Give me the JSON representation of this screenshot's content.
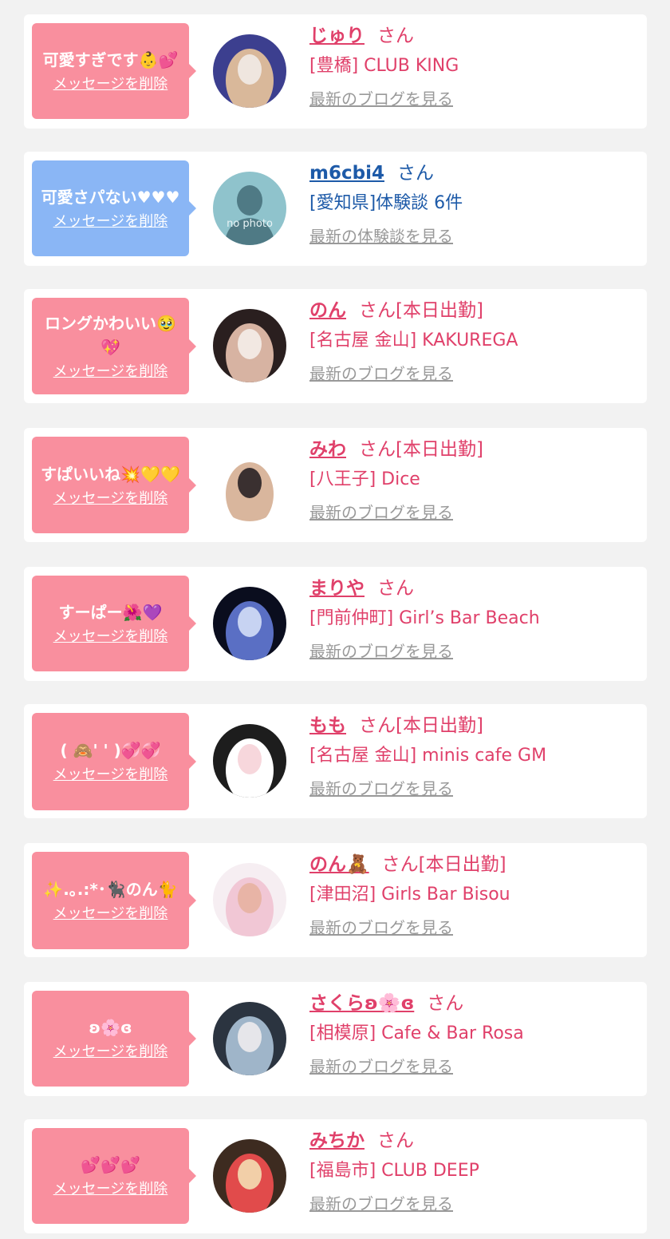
{
  "colors": {
    "page_bg": "#f2f2f2",
    "card_bg": "#ffffff",
    "bubble_pink": "#f98f9e",
    "bubble_blue": "#8ab6f5",
    "name_pink": "#e0406a",
    "name_blue": "#1d5aa8",
    "link_gray": "#999999"
  },
  "delete_label": "メッセージを削除",
  "entries": [
    {
      "message": "可愛すぎです👶💕",
      "name": "じゅり",
      "honorific": "さん",
      "tag": "",
      "shop": "[豊橋] CLUB KING",
      "link": "最新のブログを見る",
      "avatar_icon": "photo-avatar-icon",
      "theme": "pink"
    },
    {
      "message": "可愛さパない♥♥♥",
      "name": "m6cbi4",
      "honorific": "さん",
      "tag": "",
      "shop": "[愛知県]体験談 6件",
      "link": "最新の体験談を見る",
      "avatar_icon": "no-photo-avatar-icon",
      "avatar_text": "no photo",
      "theme": "blue"
    },
    {
      "message": "ロングかわいい🥹💖",
      "name": "のん",
      "honorific": "さん",
      "tag": "[本日出勤]",
      "shop": "[名古屋 金山] KAKUREGA",
      "link": "最新のブログを見る",
      "avatar_icon": "photo-avatar-icon",
      "theme": "pink"
    },
    {
      "message": "すぱいいね💥💛💛",
      "name": "みわ",
      "honorific": "さん",
      "tag": "[本日出勤]",
      "shop": "[八王子] Dice",
      "link": "最新のブログを見る",
      "avatar_icon": "photo-avatar-icon",
      "theme": "pink"
    },
    {
      "message": "すーぱー🌺💜",
      "name": "まりや",
      "honorific": "さん",
      "tag": "",
      "shop": "[門前仲町] Girl’s Bar Beach",
      "link": "最新のブログを見る",
      "avatar_icon": "photo-avatar-icon",
      "theme": "pink"
    },
    {
      "message": "( 🙈' ' )💞💞",
      "name": "もも",
      "honorific": "さん",
      "tag": "[本日出勤]",
      "shop": "[名古屋 金山] minis cafe GM",
      "link": "最新のブログを見る",
      "avatar_icon": "photo-avatar-icon",
      "theme": "pink"
    },
    {
      "message": "✨.｡.:*･🐈‍⬛のん🐈",
      "name": "のん🧸",
      "honorific": "さん",
      "tag": "[本日出勤]",
      "shop": "[津田沼] Girls Bar Bisou",
      "link": "最新のブログを見る",
      "avatar_icon": "photo-avatar-icon",
      "theme": "pink"
    },
    {
      "message": "ʚ🌸ɞ",
      "name": "さくらʚ🌸ɞ",
      "honorific": "さん",
      "tag": "",
      "shop": "[相模原] Cafe & Bar Rosa",
      "link": "最新のブログを見る",
      "avatar_icon": "photo-avatar-icon",
      "theme": "pink"
    },
    {
      "message": "💕💕💕",
      "name": "みちか",
      "honorific": "さん",
      "tag": "",
      "shop": "[福島市] CLUB DEEP",
      "link": "最新のブログを見る",
      "avatar_icon": "photo-avatar-icon",
      "theme": "pink"
    }
  ]
}
